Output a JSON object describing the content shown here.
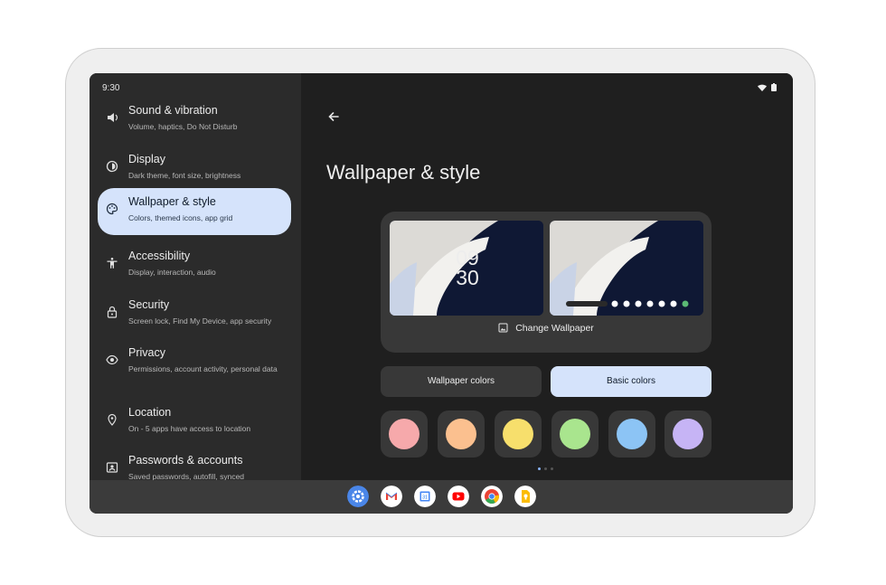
{
  "status_bar": {
    "time": "9:30"
  },
  "sidebar": {
    "items": [
      {
        "title": "Sound & vibration",
        "subtitle": "Volume, haptics, Do Not Disturb",
        "icon": "volume-icon"
      },
      {
        "title": "Display",
        "subtitle": "Dark theme, font size, brightness",
        "icon": "brightness-icon"
      },
      {
        "title": "Wallpaper & style",
        "subtitle": "Colors, themed icons, app grid",
        "icon": "palette-icon",
        "active": true
      },
      {
        "title": "Accessibility",
        "subtitle": "Display, interaction, audio",
        "icon": "accessibility-icon"
      },
      {
        "title": "Security",
        "subtitle": "Screen lock, Find My Device, app security",
        "icon": "lock-icon"
      },
      {
        "title": "Privacy",
        "subtitle": "Permissions, account activity, personal data",
        "icon": "privacy-eye-icon"
      },
      {
        "title": "Location",
        "subtitle": "On - 5 apps have access to location",
        "icon": "location-pin-icon"
      },
      {
        "title": "Passwords & accounts",
        "subtitle": "Saved passwords, autofill, synced",
        "icon": "account-box-icon"
      }
    ]
  },
  "main": {
    "title": "Wallpaper & style",
    "lock_clock_hour": "09",
    "lock_clock_minute": "30",
    "change_wallpaper_label": "Change Wallpaper",
    "tabs": {
      "wallpaper_colors": "Wallpaper colors",
      "basic_colors": "Basic colors",
      "selected": "Basic colors"
    },
    "swatches": [
      "#f6a9ab",
      "#fbc08f",
      "#f7df6c",
      "#a9e58e",
      "#8cc4f5",
      "#c6b4f5"
    ]
  },
  "dock": {
    "apps": [
      "settings-app-icon",
      "gmail-app-icon",
      "calendar-app-icon",
      "youtube-app-icon",
      "chrome-app-icon",
      "keep-app-icon"
    ],
    "calendar_day": "31"
  },
  "colors": {
    "accent": "#d5e3fb",
    "background": "#1f1f1f",
    "sidebar": "#2b2b2b"
  }
}
